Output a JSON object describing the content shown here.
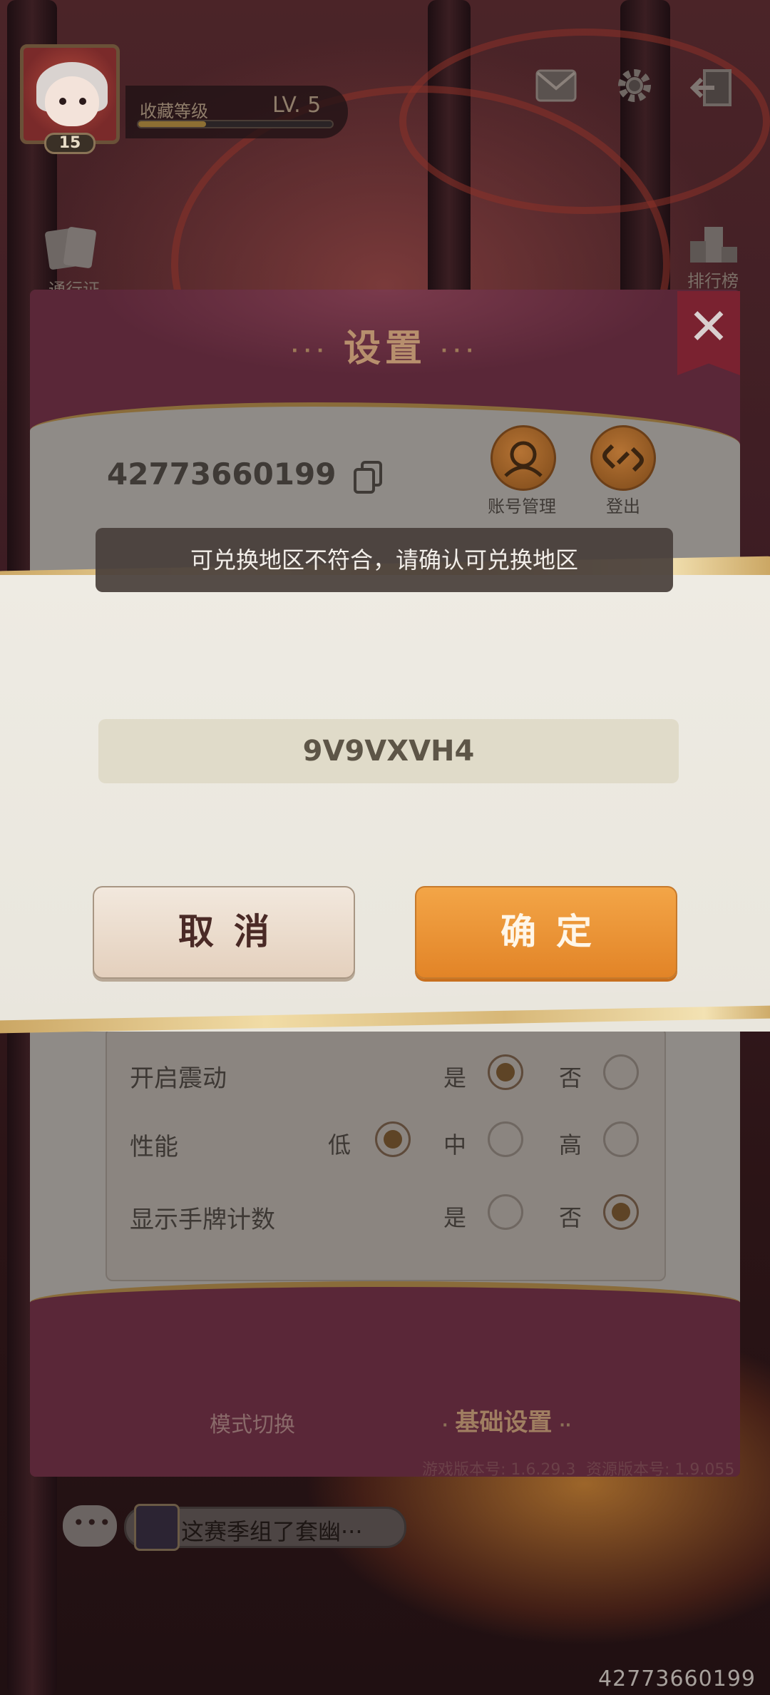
{
  "hud": {
    "avatar_level": "15",
    "collection_label": "收藏等级",
    "collection_level": "LV. 5",
    "collection_progress": 0.35,
    "side_left_label": "通行证",
    "side_right_label": "排行榜"
  },
  "settings_panel": {
    "title": "设置",
    "uid": "42773660199",
    "account_manage_label": "账号管理",
    "logout_label": "登出",
    "options": [
      {
        "label": "开启震动",
        "choices": [
          "是",
          "否"
        ],
        "selected": "是"
      },
      {
        "label": "性能",
        "choices": [
          "低",
          "中",
          "高"
        ],
        "selected": "低"
      },
      {
        "label": "显示手牌计数",
        "choices": [
          "是",
          "否"
        ],
        "selected": "否"
      }
    ],
    "tab_mode": "模式切换",
    "tab_basic": "基础设置",
    "game_version": "游戏版本号: 1.6.29.3",
    "resource_version": "资源版本号: 1.9.055"
  },
  "toast": {
    "message": "可兑换地区不符合，请确认可兑换地区"
  },
  "redeem_dialog": {
    "code_value": "9V9VXVH4",
    "cancel_label": "取消",
    "confirm_label": "确定"
  },
  "chat": {
    "preview_text": "这赛季组了套幽···"
  },
  "watermark": "42773660199",
  "colors": {
    "confirm_button": "#E88C2C",
    "cancel_button": "#EDE0D2",
    "panel_maroon": "#5A2738",
    "gold_trim": "#D8B879"
  }
}
